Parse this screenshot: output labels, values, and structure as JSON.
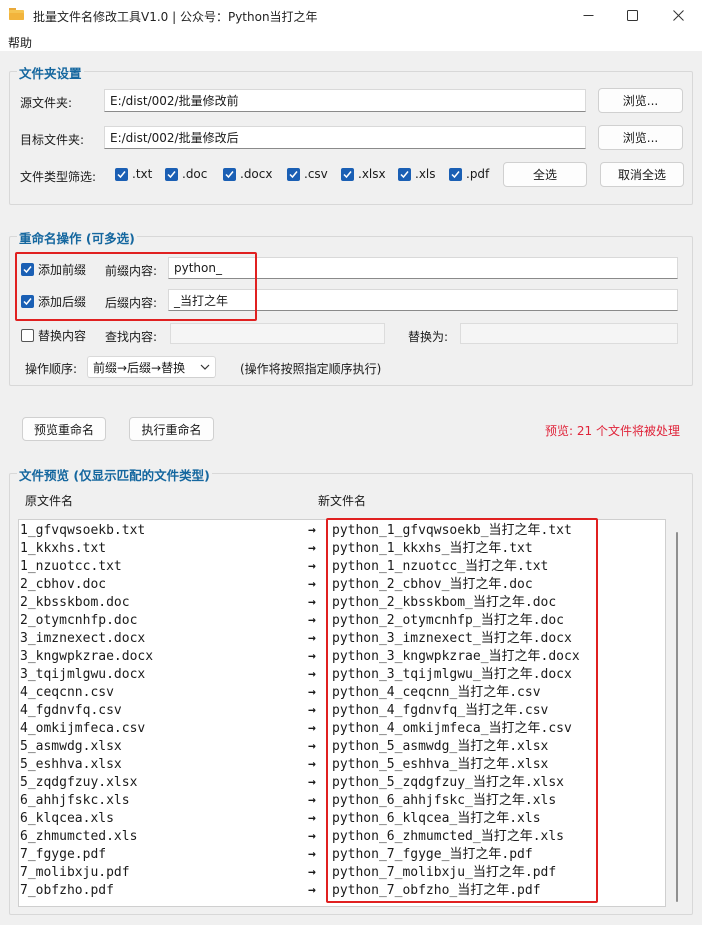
{
  "window": {
    "title": "批量文件名修改工具V1.0 | 公众号：Python当打之年",
    "menu": [
      "帮助"
    ]
  },
  "folder_settings": {
    "title": "文件夹设置",
    "source_label": "源文件夹:",
    "source_value": "E:/dist/002/批量修改前",
    "target_label": "目标文件夹:",
    "target_value": "E:/dist/002/批量修改后",
    "browse_label": "浏览...",
    "filter_label": "文件类型筛选:",
    "file_types": [
      {
        "label": ".txt",
        "checked": true
      },
      {
        "label": ".doc",
        "checked": true
      },
      {
        "label": ".docx",
        "checked": true
      },
      {
        "label": ".csv",
        "checked": true
      },
      {
        "label": ".xlsx",
        "checked": true
      },
      {
        "label": ".xls",
        "checked": true
      },
      {
        "label": ".pdf",
        "checked": true
      }
    ],
    "select_all": "全选",
    "deselect_all": "取消全选"
  },
  "rename_ops": {
    "title": "重命名操作 (可多选)",
    "add_prefix": {
      "label": "添加前缀",
      "checked": true
    },
    "prefix_label": "前缀内容:",
    "prefix_value": "python_",
    "add_suffix": {
      "label": "添加后缀",
      "checked": true
    },
    "suffix_label": "后缀内容:",
    "suffix_value": "_当打之年",
    "replace": {
      "label": "替换内容",
      "checked": false
    },
    "find_label": "查找内容:",
    "find_value": "",
    "replace_with_label": "替换为:",
    "replace_with_value": "",
    "order_label": "操作顺序:",
    "order_value": "前缀→后缀→替换",
    "order_hint": "(操作将按照指定顺序执行)"
  },
  "actions": {
    "preview": "预览重命名",
    "execute": "执行重命名",
    "status": "预览: 21 个文件将被处理",
    "status_color": "#e0243a"
  },
  "preview": {
    "title": "文件预览 (仅显示匹配的文件类型)",
    "col_old": "原文件名",
    "col_new": "新文件名",
    "arrow": "→",
    "rows": [
      {
        "old": "1_gfvqwsoekb.txt",
        "new": "python_1_gfvqwsoekb_当打之年.txt"
      },
      {
        "old": "1_kkxhs.txt",
        "new": "python_1_kkxhs_当打之年.txt"
      },
      {
        "old": "1_nzuotcc.txt",
        "new": "python_1_nzuotcc_当打之年.txt"
      },
      {
        "old": "2_cbhov.doc",
        "new": "python_2_cbhov_当打之年.doc"
      },
      {
        "old": "2_kbsskbom.doc",
        "new": "python_2_kbsskbom_当打之年.doc"
      },
      {
        "old": "2_otymcnhfp.doc",
        "new": "python_2_otymcnhfp_当打之年.doc"
      },
      {
        "old": "3_imznexect.docx",
        "new": "python_3_imznexect_当打之年.docx"
      },
      {
        "old": "3_kngwpkzrae.docx",
        "new": "python_3_kngwpkzrae_当打之年.docx"
      },
      {
        "old": "3_tqijmlgwu.docx",
        "new": "python_3_tqijmlgwu_当打之年.docx"
      },
      {
        "old": "4_ceqcnn.csv",
        "new": "python_4_ceqcnn_当打之年.csv"
      },
      {
        "old": "4_fgdnvfq.csv",
        "new": "python_4_fgdnvfq_当打之年.csv"
      },
      {
        "old": "4_omkijmfeca.csv",
        "new": "python_4_omkijmfeca_当打之年.csv"
      },
      {
        "old": "5_asmwdg.xlsx",
        "new": "python_5_asmwdg_当打之年.xlsx"
      },
      {
        "old": "5_eshhva.xlsx",
        "new": "python_5_eshhva_当打之年.xlsx"
      },
      {
        "old": "5_zqdgfzuy.xlsx",
        "new": "python_5_zqdgfzuy_当打之年.xlsx"
      },
      {
        "old": "6_ahhjfskc.xls",
        "new": "python_6_ahhjfskc_当打之年.xls"
      },
      {
        "old": "6_klqcea.xls",
        "new": "python_6_klqcea_当打之年.xls"
      },
      {
        "old": "6_zhmumcted.xls",
        "new": "python_6_zhmumcted_当打之年.xls"
      },
      {
        "old": "7_fgyge.pdf",
        "new": "python_7_fgyge_当打之年.pdf"
      },
      {
        "old": "7_molibxju.pdf",
        "new": "python_7_molibxju_当打之年.pdf"
      },
      {
        "old": "7_obfzho.pdf",
        "new": "python_7_obfzho_当打之年.pdf"
      }
    ]
  }
}
